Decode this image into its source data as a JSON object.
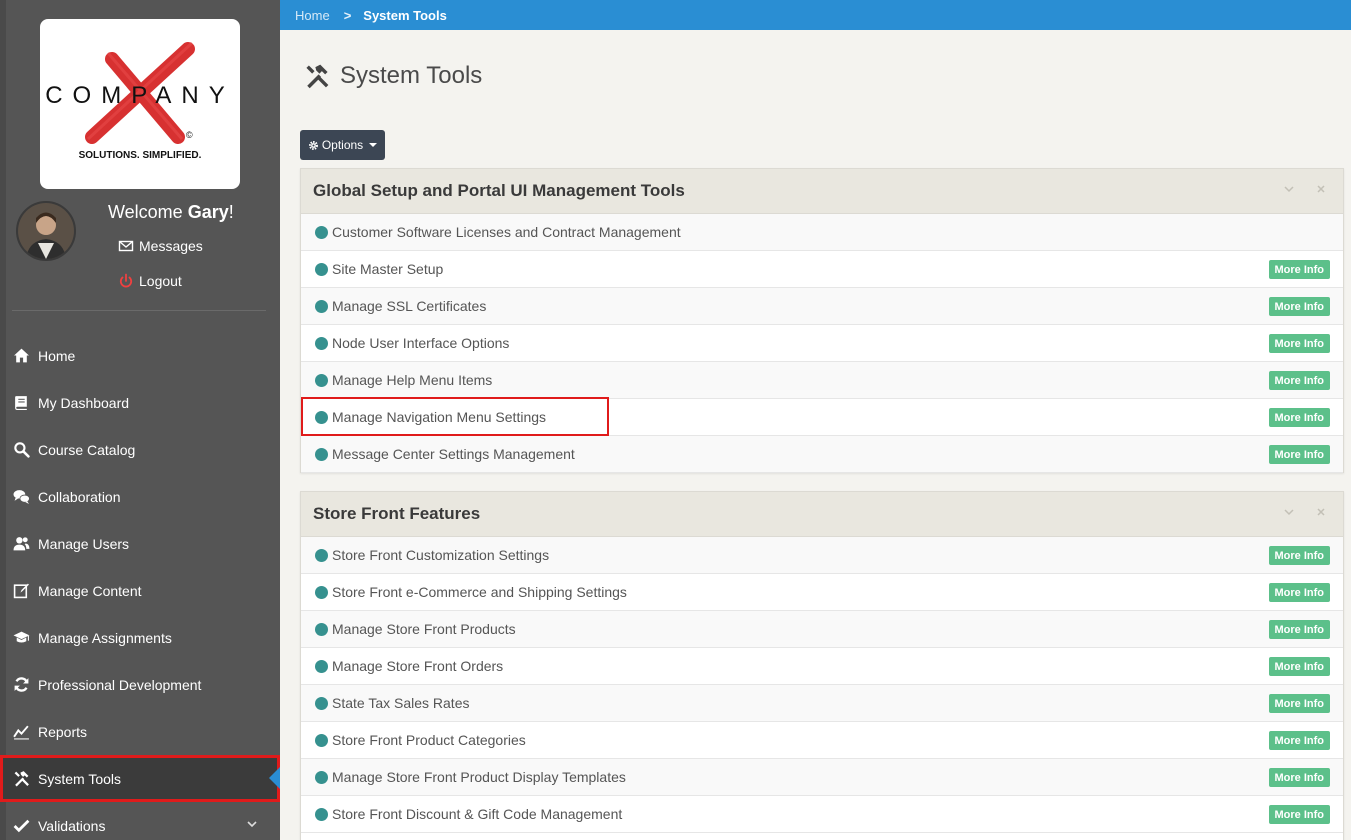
{
  "branding": {
    "logo_word": "COMPANY",
    "logo_tagline": "SOLUTIONS. SIMPLIFIED.",
    "logo_mark": "©"
  },
  "user": {
    "welcome_prefix": "Welcome",
    "name": "Gary",
    "welcome_suffix": "!"
  },
  "account_links": {
    "messages": "Messages",
    "logout": "Logout"
  },
  "sidebar": {
    "items": [
      {
        "label": "Home",
        "icon": "home-icon"
      },
      {
        "label": "My Dashboard",
        "icon": "book-icon"
      },
      {
        "label": "Course Catalog",
        "icon": "search-icon"
      },
      {
        "label": "Collaboration",
        "icon": "comments-icon"
      },
      {
        "label": "Manage Users",
        "icon": "users-icon"
      },
      {
        "label": "Manage Content",
        "icon": "edit-icon"
      },
      {
        "label": "Manage Assignments",
        "icon": "graduation-cap-icon"
      },
      {
        "label": "Professional Development",
        "icon": "refresh-icon"
      },
      {
        "label": "Reports",
        "icon": "line-chart-icon"
      },
      {
        "label": "System Tools",
        "icon": "tools-icon",
        "active": true
      },
      {
        "label": "Validations",
        "icon": "check-icon",
        "has_submenu": true
      }
    ]
  },
  "breadcrumb": {
    "home": "Home",
    "separator": ">",
    "current": "System Tools"
  },
  "page": {
    "title": "System Tools"
  },
  "toolbar": {
    "options_label": "Options"
  },
  "panels": [
    {
      "title": "Global Setup and Portal UI Management Tools",
      "rows": [
        {
          "label": "Customer Software Licenses and Contract Management",
          "more": ""
        },
        {
          "label": "Site Master Setup",
          "more": "More Info"
        },
        {
          "label": "Manage SSL Certificates",
          "more": "More Info"
        },
        {
          "label": "Node User Interface Options",
          "more": "More Info"
        },
        {
          "label": "Manage Help Menu Items",
          "more": "More Info"
        },
        {
          "label": "Manage Navigation Menu Settings",
          "more": "More Info"
        },
        {
          "label": "Message Center Settings Management",
          "more": "More Info"
        }
      ]
    },
    {
      "title": "Store Front Features",
      "rows": [
        {
          "label": "Store Front Customization Settings",
          "more": "More Info"
        },
        {
          "label": "Store Front e-Commerce and Shipping Settings",
          "more": "More Info"
        },
        {
          "label": "Manage Store Front Products",
          "more": "More Info"
        },
        {
          "label": "Manage Store Front Orders",
          "more": "More Info"
        },
        {
          "label": "State Tax Sales Rates",
          "more": "More Info"
        },
        {
          "label": "Store Front Product Categories",
          "more": "More Info"
        },
        {
          "label": "Manage Store Front Product Display Templates",
          "more": "More Info"
        },
        {
          "label": "Store Front Discount & Gift Code Management",
          "more": "More Info"
        }
      ]
    }
  ],
  "colors": {
    "sidebar_bg": "#555555",
    "topbar_bg": "#2a8ed3",
    "bullet": "#36918f",
    "more_info": "#5cc08a",
    "highlight": "#e01b1b"
  }
}
